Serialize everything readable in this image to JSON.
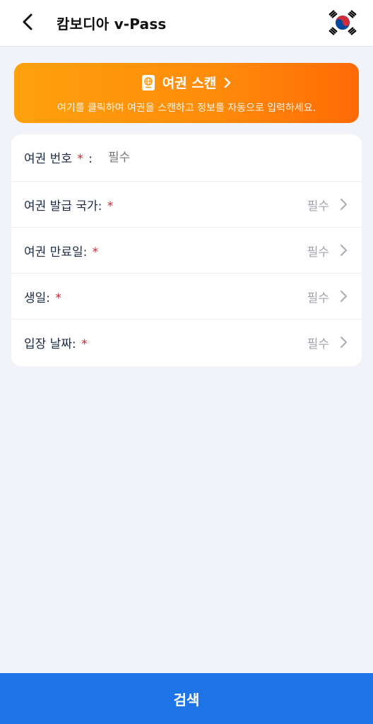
{
  "header": {
    "title": "캄보디아 v-Pass",
    "back_icon": "chevron-left-icon",
    "flag_icon": "south-korea-flag-icon"
  },
  "scan_banner": {
    "title": "여권 스캔",
    "description": "여기를 클릭하여 여권을 스캔하고 정보를 자동으로 입력하세요.",
    "icon": "passport-icon",
    "colors": {
      "start": "#ffa10d",
      "end": "#ff6a05"
    }
  },
  "form": {
    "passport_number": {
      "label": "여권 번호",
      "required_mark": "*",
      "colon": ":",
      "placeholder": "필수"
    },
    "issuing_country": {
      "label": "여권 발급 국가:",
      "required_mark": "*",
      "value": "필수"
    },
    "expiry_date": {
      "label": "여권 만료일:",
      "required_mark": "*",
      "value": "필수"
    },
    "birth_date": {
      "label": "생일:",
      "required_mark": "*",
      "value": "필수"
    },
    "entry_date": {
      "label": "입장 날짜:",
      "required_mark": "*",
      "value": "필수"
    }
  },
  "search_button": {
    "label": "검색",
    "color": "#1d74e6"
  }
}
